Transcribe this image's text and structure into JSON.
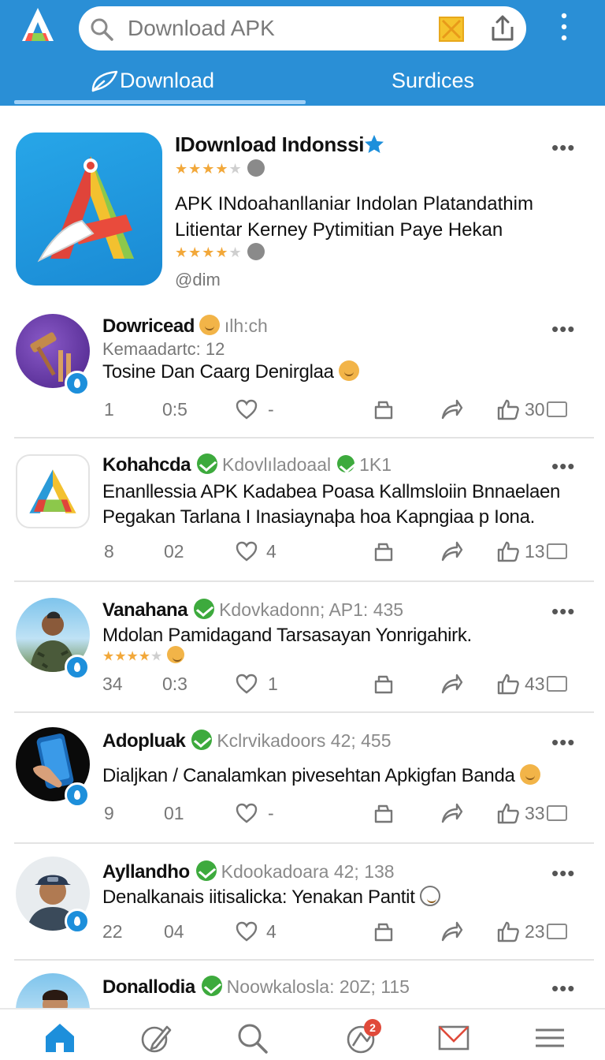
{
  "header": {
    "search_placeholder": "Download APK",
    "tabs": [
      {
        "label": "Download",
        "active": true
      },
      {
        "label": "Surdices",
        "active": false
      }
    ],
    "accent_color": "#2a8fd6"
  },
  "featured": {
    "title": "IDownload Indonssi",
    "more": "•••",
    "description": "APK INdoahanllaniar Indolan Platandathim Litientar Kerney Pytimitian Paye Hekan",
    "handle": "@dim",
    "rating_stars": 4
  },
  "posts": [
    {
      "name": "Dowricead",
      "meta": "ılh:ch",
      "sub": "Kemaadartc: 12",
      "body": "Tosine Dan Caarg Denirglaa",
      "more": "•••",
      "counts": [
        "1",
        "0:5",
        "-",
        "30"
      ]
    },
    {
      "name": "Kohahcda",
      "meta": "Kdovlıladoaal",
      "meta2": "1K1",
      "body": "Enanllessia APK Kadabea Poasa Kallmsloiin Bnnaelaen Pegakan Tarlana I Inasiaynaþa hoa Kapngiaa p Iona.",
      "more": "•••",
      "counts": [
        "8",
        "02",
        "4",
        "13"
      ]
    },
    {
      "name": "Vanahana",
      "meta": "Kdovkadonn; AP1: 435",
      "body": "Mdolan Pamidagand Tarsasayan Yonrigahirk.",
      "more": "•••",
      "counts": [
        "34",
        "0:3",
        "1",
        "43"
      ]
    },
    {
      "name": "Adopluak",
      "meta": "Kclrvikadoors 42; 455",
      "body": "Dialjkan / Canalamkan pivesehtan Apkigfan Banda",
      "more": "•••",
      "counts": [
        "9",
        "01",
        "-",
        "33"
      ]
    },
    {
      "name": "Ayllandho",
      "meta": "Kdookadoara 42; 138",
      "body": "Denalkanais iitisalicka: Yenakan Pantit",
      "more": "•••",
      "counts": [
        "22",
        "04",
        "4",
        "23"
      ]
    },
    {
      "name": "Donallodia",
      "meta": "Noowkalosla: 20Z; 115",
      "more": "•••"
    }
  ],
  "bottom_nav": {
    "items": [
      "home-icon",
      "edit-icon",
      "search-icon",
      "notifications-icon",
      "mail-icon",
      "menu-icon"
    ],
    "notification_count": "2"
  }
}
